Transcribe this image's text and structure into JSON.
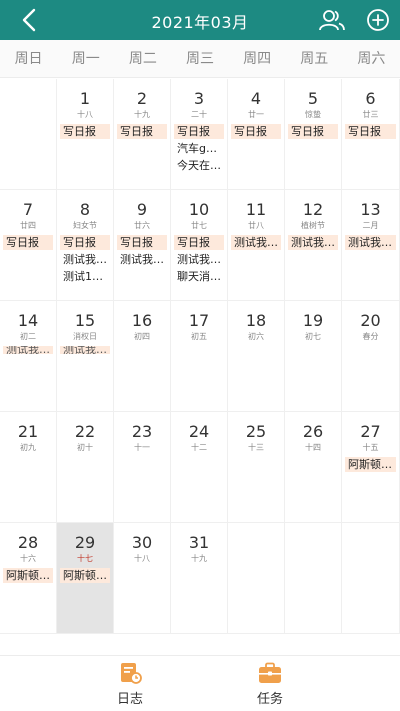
{
  "header": {
    "title": "2021年03月",
    "back_icon": "back-arrow-icon",
    "contacts_icon": "people-icon",
    "add_icon": "add-circle-icon",
    "color": "#1d8a82"
  },
  "weekdays": [
    "周日",
    "周一",
    "周二",
    "周三",
    "周四",
    "周五",
    "周六"
  ],
  "calendar": {
    "today_day": "29",
    "cells": [
      {
        "day": "",
        "lunar": "",
        "events": []
      },
      {
        "day": "1",
        "lunar": "十八",
        "events": [
          "写日报"
        ]
      },
      {
        "day": "2",
        "lunar": "十九",
        "events": [
          "写日报"
        ]
      },
      {
        "day": "3",
        "lunar": "二十",
        "events": [
          "写日报",
          "汽车g…",
          "今天在…"
        ]
      },
      {
        "day": "4",
        "lunar": "廿一",
        "events": [
          "写日报"
        ]
      },
      {
        "day": "5",
        "lunar": "惊蛰",
        "events": [
          "写日报"
        ]
      },
      {
        "day": "6",
        "lunar": "廿三",
        "events": [
          "写日报"
        ]
      },
      {
        "day": "7",
        "lunar": "廿四",
        "events": [
          "写日报"
        ]
      },
      {
        "day": "8",
        "lunar": "妇女节",
        "events": [
          "写日报",
          "测试我…",
          "测试1…"
        ]
      },
      {
        "day": "9",
        "lunar": "廿六",
        "events": [
          "写日报",
          "测试我…"
        ]
      },
      {
        "day": "10",
        "lunar": "廿七",
        "events": [
          "写日报",
          "测试我…",
          "聊天消…"
        ]
      },
      {
        "day": "11",
        "lunar": "廿八",
        "events": [
          "测试我…"
        ]
      },
      {
        "day": "12",
        "lunar": "植树节",
        "events": [
          "测试我…"
        ]
      },
      {
        "day": "13",
        "lunar": "二月",
        "events": [
          "测试我…"
        ]
      },
      {
        "day": "14",
        "lunar": "初二",
        "events": [
          "测试我…"
        ]
      },
      {
        "day": "15",
        "lunar": "消权日",
        "events": [
          "测试我…"
        ]
      },
      {
        "day": "16",
        "lunar": "初四",
        "events": []
      },
      {
        "day": "17",
        "lunar": "初五",
        "events": []
      },
      {
        "day": "18",
        "lunar": "初六",
        "events": []
      },
      {
        "day": "19",
        "lunar": "初七",
        "events": []
      },
      {
        "day": "20",
        "lunar": "春分",
        "events": []
      },
      {
        "day": "21",
        "lunar": "初九",
        "events": []
      },
      {
        "day": "22",
        "lunar": "初十",
        "events": []
      },
      {
        "day": "23",
        "lunar": "十一",
        "events": []
      },
      {
        "day": "24",
        "lunar": "十二",
        "events": []
      },
      {
        "day": "25",
        "lunar": "十三",
        "events": []
      },
      {
        "day": "26",
        "lunar": "十四",
        "events": []
      },
      {
        "day": "27",
        "lunar": "十五",
        "events": [
          "阿斯顿…"
        ]
      },
      {
        "day": "28",
        "lunar": "十六",
        "events": [
          "阿斯顿…"
        ]
      },
      {
        "day": "29",
        "lunar": "十七",
        "events": [
          "阿斯顿…"
        ]
      },
      {
        "day": "30",
        "lunar": "十八",
        "events": []
      },
      {
        "day": "31",
        "lunar": "十九",
        "events": []
      },
      {
        "day": "",
        "lunar": "",
        "events": []
      },
      {
        "day": "",
        "lunar": "",
        "events": []
      },
      {
        "day": "",
        "lunar": "",
        "events": []
      }
    ]
  },
  "tabbar": {
    "log_label": "日志",
    "task_label": "任务",
    "log_icon": "log-icon",
    "task_icon": "briefcase-icon",
    "icon_color": "#f0a04b"
  }
}
